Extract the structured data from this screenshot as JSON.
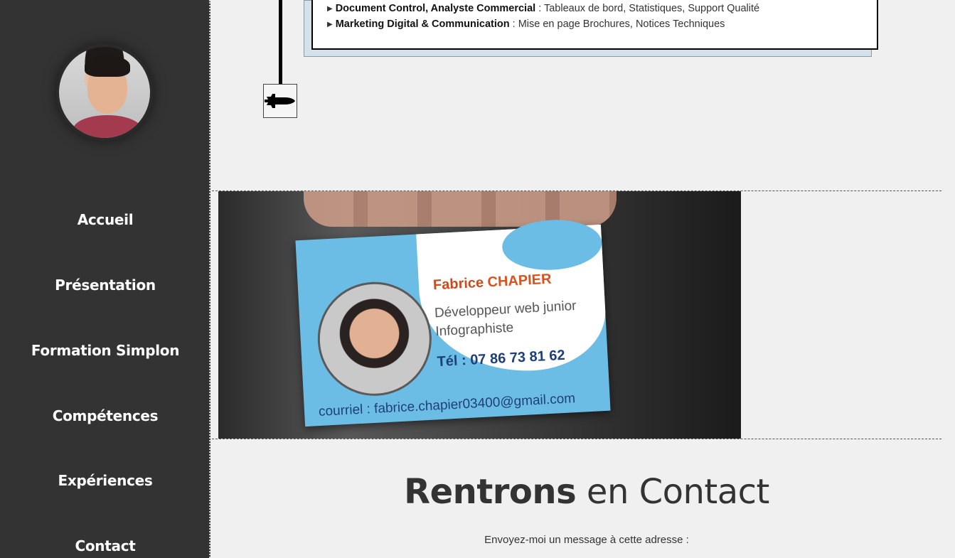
{
  "sidebar": {
    "nav": [
      {
        "label": "Accueil"
      },
      {
        "label": "Présentation"
      },
      {
        "label": "Formation Simplon"
      },
      {
        "label": "Compétences"
      },
      {
        "label": "Expériences"
      },
      {
        "label": "Contact"
      }
    ]
  },
  "experience_card": {
    "lines": [
      {
        "title": "Document Control, Analyste Commercial",
        "detail": " : Tableaux de bord, Statistiques, Support Qualité"
      },
      {
        "title": "Marketing Digital & Communication",
        "detail": " : Mise en page Brochures, Notices Techniques"
      }
    ]
  },
  "banner": {
    "name_first": "Fabrice ",
    "name_last": "CHAPIER",
    "role_1": "Développeur web junior",
    "role_2": "Infographiste",
    "tel": "Tél : 07 86 73 81 62",
    "mail": "courriel : fabrice.chapier03400@gmail.com"
  },
  "contact": {
    "title_bold": "Rentrons",
    "title_rest": " en Contact",
    "text": "Envoyez-moi un message à cette adresse :"
  }
}
